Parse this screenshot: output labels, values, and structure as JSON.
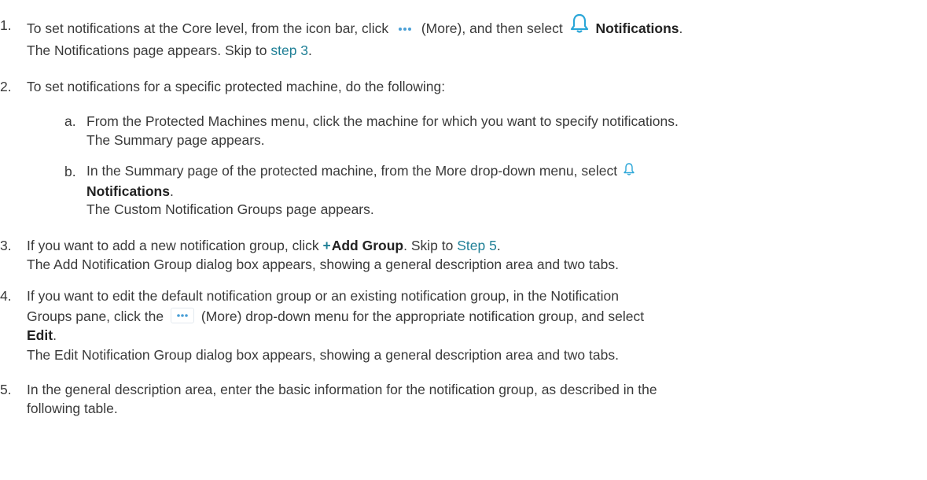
{
  "steps": [
    {
      "number": "1.",
      "text_a": "To set notifications at the Core level, from the icon bar, click",
      "text_b": "(More), and then select",
      "bold": "Notifications",
      "end": ".",
      "line2_a": "The  Notifications page appears. Skip to",
      "link": "step 3",
      "line2_end": "."
    },
    {
      "number": "2.",
      "text": "To set notifications for a specific protected machine, do the following:",
      "substeps": [
        {
          "letter": "a.",
          "line1": "From the Protected Machines menu, click the machine for which you want to specify notifications.",
          "line2": "The Summary page appears."
        },
        {
          "letter": "b.",
          "line1": "In the Summary page of the protected machine, from the More drop-down menu, select",
          "bold": "Notifications",
          "end": ".",
          "line3": "The Custom Notification Groups page appears."
        }
      ]
    },
    {
      "number": "3.",
      "text_a": "If you want to add a new notification group, click",
      "plus": "+",
      "bold": "Add Group",
      "text_b": ". Skip to",
      "link": "Step 5",
      "end": ".",
      "line2": "The Add Notification Group dialog box appears, showing a general description area and two tabs."
    },
    {
      "number": "4.",
      "line1": "If you want to edit the default notification group or an existing notification group, in the Notification",
      "line2_a": "Groups pane, click the",
      "line2_b": "(More) drop-down menu for the appropriate notification group, and select",
      "bold": "Edit",
      "end": ".",
      "line4": "The Edit Notification Group dialog box appears, showing a general description area and two tabs."
    },
    {
      "number": "5.",
      "line1": "In the general description area, enter the basic information for the notification group, as described in the",
      "line2": "following table."
    }
  ],
  "icons": {
    "more": "more-dots-icon",
    "bell": "bell-icon",
    "accent": "#1f7f96"
  }
}
